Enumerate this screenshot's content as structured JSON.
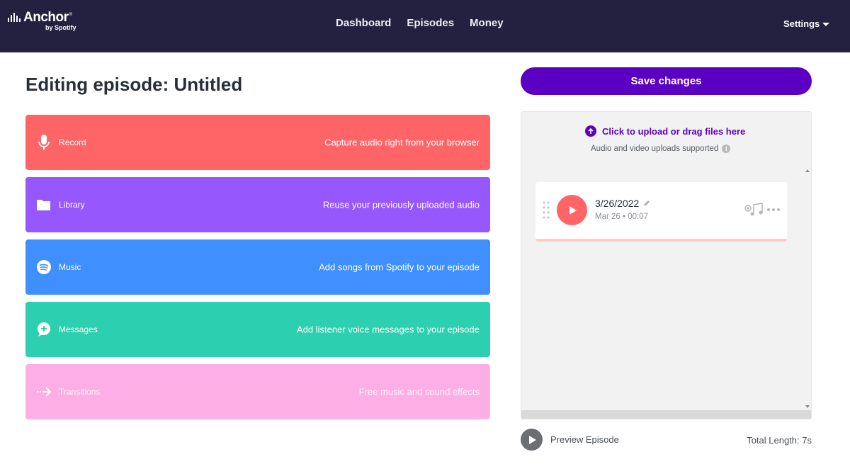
{
  "header": {
    "brand_name": "Anchor",
    "brand_reg": "®",
    "brand_sub": "by Spotify",
    "nav": [
      {
        "label": "Dashboard"
      },
      {
        "label": "Episodes"
      },
      {
        "label": "Money"
      }
    ],
    "settings_label": "Settings"
  },
  "page": {
    "title": "Editing episode: Untitled"
  },
  "tools": [
    {
      "name": "Record",
      "description": "Capture audio right from your browser",
      "icon": "microphone-icon",
      "color": "#ff6566"
    },
    {
      "name": "Library",
      "description": "Reuse your previously uploaded audio",
      "icon": "folder-icon",
      "color": "#9657fc"
    },
    {
      "name": "Music",
      "description": "Add songs from Spotify to your episode",
      "icon": "spotify-icon",
      "color": "#3f8ffe"
    },
    {
      "name": "Messages",
      "description": "Add listener voice messages to your episode",
      "icon": "message-plus-icon",
      "color": "#2dcfb1"
    },
    {
      "name": "Transitions",
      "description": "Free music and sound effects",
      "icon": "arrow-right-icon",
      "color": "#fdaee4"
    }
  ],
  "editor": {
    "save_label": "Save changes",
    "upload_label": "Click to upload or drag files here",
    "upload_note": "Audio and video uploads supported",
    "segment": {
      "title": "3/26/2022",
      "meta": "Mar 26 • 00:07"
    },
    "preview_label": "Preview Episode",
    "total_length": "Total Length: 7s"
  },
  "colors": {
    "header_bg": "#24203f",
    "accent_purple": "#5b00c2"
  }
}
